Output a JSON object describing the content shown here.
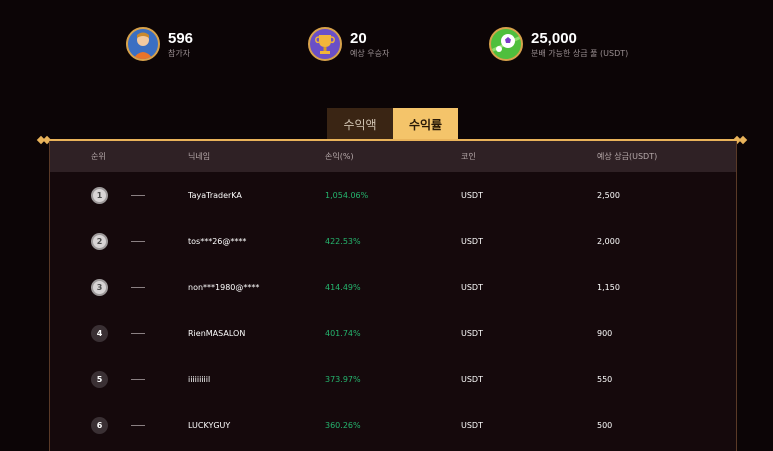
{
  "stats": [
    {
      "icon": "participant-avatar-icon",
      "value": "596",
      "label": "참가자"
    },
    {
      "icon": "trophy-icon",
      "value": "20",
      "label": "예상 우승자"
    },
    {
      "icon": "soccer-ball-icon",
      "value": "25,000",
      "label": "분배 가능한 상금 풀 (USDT)"
    }
  ],
  "tabs": [
    {
      "label": "수익액",
      "active": false
    },
    {
      "label": "수익률",
      "active": true
    }
  ],
  "table": {
    "headers": [
      "순위",
      "닉네임",
      "손익(%)",
      "코인",
      "예상 상금(USDT)"
    ],
    "rows": [
      {
        "rank": "1",
        "nickname": "TayaTraderKA",
        "pnl": "1,054.06%",
        "coin": "USDT",
        "prize": "2,500",
        "medal": true
      },
      {
        "rank": "2",
        "nickname": "tos***26@****",
        "pnl": "422.53%",
        "coin": "USDT",
        "prize": "2,000",
        "medal": true
      },
      {
        "rank": "3",
        "nickname": "non***1980@****",
        "pnl": "414.49%",
        "coin": "USDT",
        "prize": "1,150",
        "medal": true
      },
      {
        "rank": "4",
        "nickname": "RienMASALON",
        "pnl": "401.74%",
        "coin": "USDT",
        "prize": "900",
        "medal": false
      },
      {
        "rank": "5",
        "nickname": "iiiiiiiiil",
        "pnl": "373.97%",
        "coin": "USDT",
        "prize": "550",
        "medal": false
      },
      {
        "rank": "6",
        "nickname": "LUCKYGUY",
        "pnl": "360.26%",
        "coin": "USDT",
        "prize": "500",
        "medal": false
      }
    ]
  },
  "colors": {
    "accent": "#f4c46a",
    "positive": "#25b56e",
    "background": "#0c0506"
  }
}
